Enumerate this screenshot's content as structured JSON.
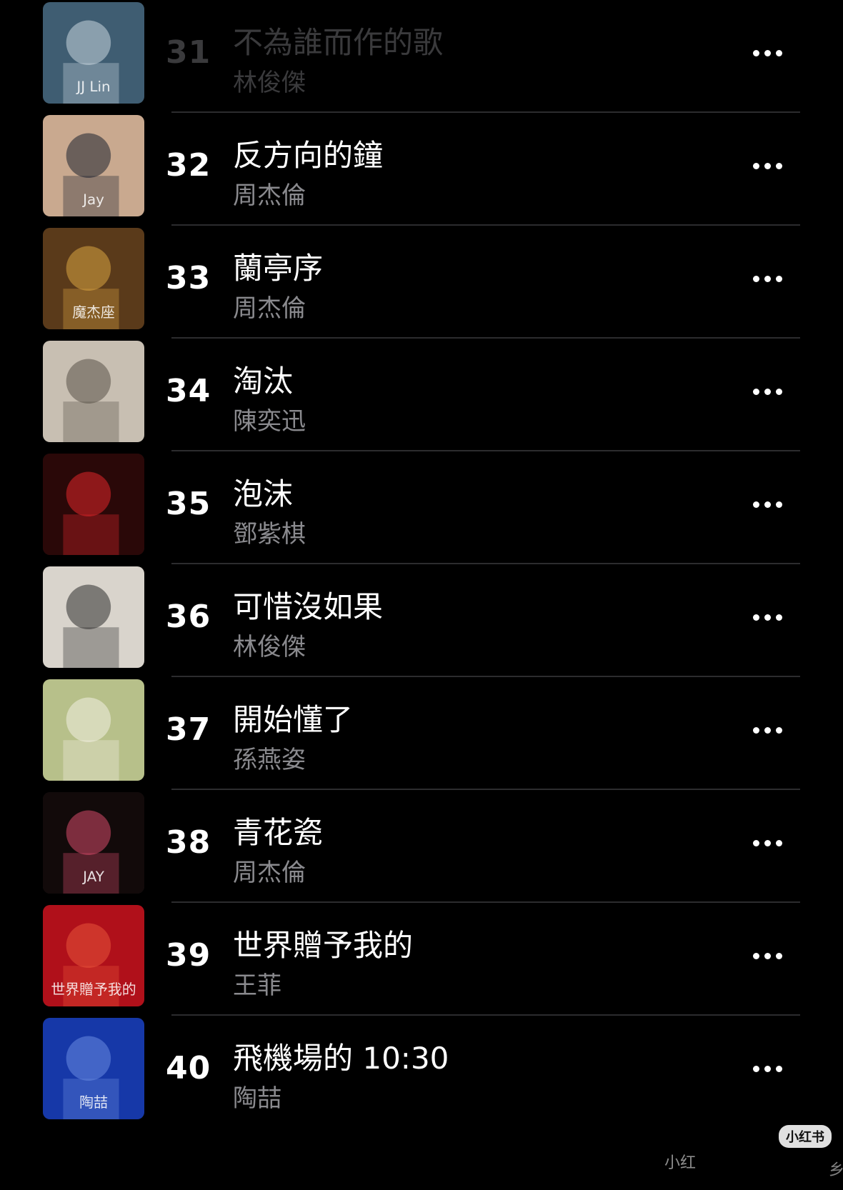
{
  "songs": [
    {
      "rank": "31",
      "title": "不為誰而作的歌",
      "artist": "林俊傑",
      "faded": true,
      "cover": {
        "bg": "#3f5d72",
        "accent": "#c9d6df",
        "text": "JJ Lin"
      }
    },
    {
      "rank": "32",
      "title": "反方向的鐘",
      "artist": "周杰倫",
      "faded": false,
      "cover": {
        "bg": "#c9a98f",
        "accent": "#1c2330",
        "text": "Jay"
      }
    },
    {
      "rank": "33",
      "title": "蘭亭序",
      "artist": "周杰倫",
      "faded": false,
      "cover": {
        "bg": "#5a3a1a",
        "accent": "#d9a441",
        "text": "魔杰座"
      }
    },
    {
      "rank": "34",
      "title": "淘汰",
      "artist": "陳奕迅",
      "faded": false,
      "cover": {
        "bg": "#c8bfb2",
        "accent": "#5a5248",
        "text": ""
      }
    },
    {
      "rank": "35",
      "title": "泡沫",
      "artist": "鄧紫棋",
      "faded": false,
      "cover": {
        "bg": "#2a0808",
        "accent": "#e0262a",
        "text": ""
      }
    },
    {
      "rank": "36",
      "title": "可惜沒如果",
      "artist": "林俊傑",
      "faded": false,
      "cover": {
        "bg": "#d9d4cc",
        "accent": "#2d2d2d",
        "text": ""
      }
    },
    {
      "rank": "37",
      "title": "開始懂了",
      "artist": "孫燕姿",
      "faded": false,
      "cover": {
        "bg": "#b7c08a",
        "accent": "#f3efe2",
        "text": ""
      }
    },
    {
      "rank": "38",
      "title": "青花瓷",
      "artist": "周杰倫",
      "faded": false,
      "cover": {
        "bg": "#120a0a",
        "accent": "#d64a6a",
        "text": "JAY"
      }
    },
    {
      "rank": "39",
      "title": "世界贈予我的",
      "artist": "王菲",
      "faded": false,
      "cover": {
        "bg": "#b0101a",
        "accent": "#e8533a",
        "text": "世界贈予我的"
      }
    },
    {
      "rank": "40",
      "title": "飛機場的 10:30",
      "artist": "陶喆",
      "faded": false,
      "cover": {
        "bg": "#1638a8",
        "accent": "#6a8be0",
        "text": "陶喆"
      }
    }
  ],
  "more_icon": "ellipsis-icon",
  "watermark": {
    "badge": "小红书",
    "text": "小红",
    "tail": "乡"
  }
}
